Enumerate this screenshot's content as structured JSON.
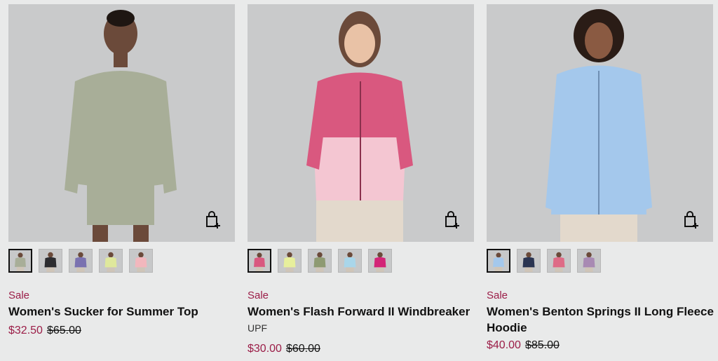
{
  "colors": {
    "sale": "#9b1e48",
    "text": "#111111",
    "background": "#e9eaea",
    "photo_bg": "#c9cacb"
  },
  "icons": {
    "add_to_bag": "bag-plus-icon"
  },
  "products": [
    {
      "badge": "Sale",
      "title": "Women's Sucker for Summer Top",
      "subtitle": "",
      "price_now": "$32.50",
      "price_was": "$65.00",
      "garment_color": "#a8ae98",
      "swatches": [
        "#a8ae98",
        "#2c2c30",
        "#7a72b0",
        "#dfe89c",
        "#f2b7bd"
      ]
    },
    {
      "badge": "Sale",
      "title": "Women's Flash Forward II Windbreaker",
      "subtitle": "UPF",
      "price_now": "$30.00",
      "price_was": "$60.00",
      "garment_color": "#d9587f",
      "swatches": [
        "#d9587f",
        "#e7ef9c",
        "#8e9a72",
        "#a9d6ea",
        "#d32477"
      ]
    },
    {
      "badge": "Sale",
      "title": "Women's Benton Springs II Long Fleece Hoodie",
      "subtitle": "",
      "price_now": "$40.00",
      "price_was": "$85.00",
      "garment_color": "#a4c8ec",
      "swatches": [
        "#a4c8ec",
        "#2b3552",
        "#de6b86",
        "#a88ab3"
      ]
    }
  ]
}
